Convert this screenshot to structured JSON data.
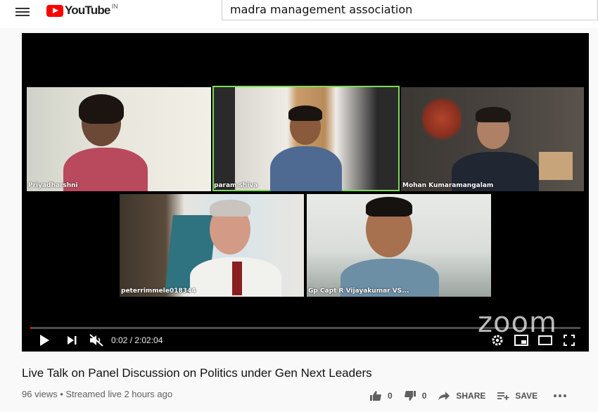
{
  "header": {
    "logo_text": "YouTube",
    "logo_country": "IN",
    "search_value": "madra management association"
  },
  "player": {
    "participants": [
      {
        "name": "Priyadharshni"
      },
      {
        "name": "param shiva"
      },
      {
        "name": "Mohan Kumaramangalam"
      },
      {
        "name": "peterrimmele018344"
      },
      {
        "name": "Gp Capt R Vijayakumar VS..."
      }
    ],
    "watermark": "zoom",
    "time_display": "0:02 / 2:02:04",
    "progress_fraction": 0.0003,
    "muted": true
  },
  "video": {
    "title": "Live Talk on Panel Discussion on Politics under Gen Next Leaders",
    "meta": "96 views • Streamed live 2 hours ago",
    "likes": "0",
    "dislikes": "0",
    "share_label": "SHARE",
    "save_label": "SAVE"
  },
  "colors": {
    "brand_red": "#ff0000",
    "active_speaker": "#7ed957"
  }
}
